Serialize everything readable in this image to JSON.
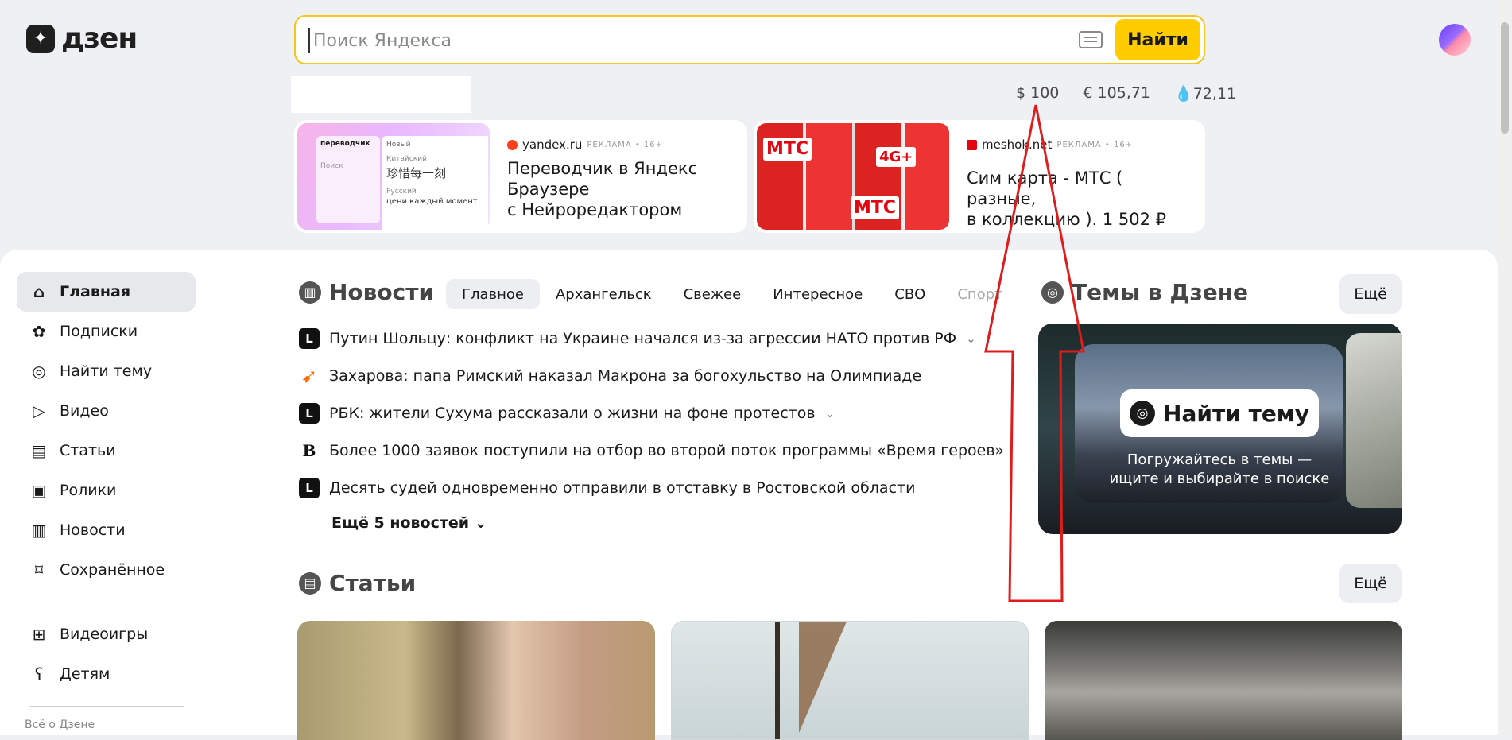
{
  "header": {
    "logo_text": "дзен",
    "search_placeholder": "Поиск Яндекса",
    "search_button": "Найти",
    "rates": [
      "$ 100",
      "€ 105,71",
      "72,11"
    ]
  },
  "ads": [
    {
      "source": "yandex.ru",
      "meta": "РЕКЛАМА • 16+",
      "title": "Переводчик в Яндекс\nБраузере\nс Нейроредактором",
      "image_labels": {
        "app": "переводчик",
        "new": "Новый",
        "lang_from": "Китайский",
        "text_from": "珍惜每一刻",
        "lang_to": "Русский",
        "text_to": "цени каждый момент",
        "search": "Поиск"
      }
    },
    {
      "source": "meshok.net",
      "meta": "РЕКЛАМА • 16+",
      "title": "Сим карта - МТС ( разные,\nв коллекцию ). 1 502 ₽",
      "image_labels": {
        "brand": "МТС",
        "badge": "4G+"
      }
    }
  ],
  "nav": {
    "items": [
      {
        "label": "Главная",
        "icon": "home-icon"
      },
      {
        "label": "Подписки",
        "icon": "subscriptions-icon"
      },
      {
        "label": "Найти тему",
        "icon": "compass-icon"
      },
      {
        "label": "Видео",
        "icon": "video-icon"
      },
      {
        "label": "Статьи",
        "icon": "articles-icon"
      },
      {
        "label": "Ролики",
        "icon": "clips-icon"
      },
      {
        "label": "Новости",
        "icon": "news-icon"
      },
      {
        "label": "Сохранённое",
        "icon": "bookmark-icon"
      }
    ],
    "extra": [
      {
        "label": "Видеоигры",
        "icon": "gamepad-icon"
      },
      {
        "label": "Детям",
        "icon": "bear-icon"
      }
    ],
    "footer": "Всё о Дзене"
  },
  "news": {
    "title": "Новости",
    "tabs": [
      "Главное",
      "Архангельск",
      "Свежее",
      "Интересное",
      "СВО",
      "Спорт"
    ],
    "items": [
      {
        "text": "Путин Шольцу: конфликт на Украине начался из-за агрессии НАТО против РФ",
        "source": "L",
        "expand": true
      },
      {
        "text": "Захарова: папа Римский наказал Макрона за богохульство на Олимпиаде",
        "source": "",
        "expand": false
      },
      {
        "text": "РБК: жители Сухума рассказали о жизни на фоне протестов",
        "source": "L",
        "expand": true
      },
      {
        "text": "Более 1000 заявок поступили на отбор во второй поток программы «Время героев»",
        "source": "B",
        "expand": false
      },
      {
        "text": "Десять судей одновременно отправили в отставку в Ростовской области",
        "source": "L",
        "expand": false
      }
    ],
    "more": "Ещё 5 новостей"
  },
  "topics": {
    "title": "Темы в Дзене",
    "more": "Ещё",
    "card_title": "Найти тему",
    "card_subtitle": "Погружайтесь в темы —\nищите и выбирайте в поиске"
  },
  "articles": {
    "title": "Статьи",
    "more": "Ещё"
  },
  "colors": {
    "accent_yellow": "#ffcc00",
    "annotation_red": "#e01b1b"
  }
}
